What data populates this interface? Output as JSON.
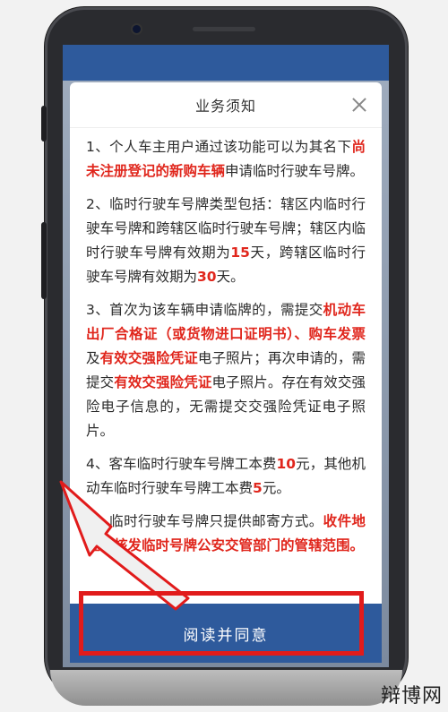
{
  "modal": {
    "title": "业务须知",
    "agree_label": "阅读并同意"
  },
  "notice": [
    {
      "segments": [
        {
          "t": "1、个人车主用户通过该功能可以为其名下"
        },
        {
          "t": "尚未注册登记的新购车辆",
          "red": true
        },
        {
          "t": "申请临时行驶车号牌。"
        }
      ]
    },
    {
      "segments": [
        {
          "t": "2、临时行驶车号牌类型包括：辖区内临时行驶车号牌和跨辖区临时行驶车号牌；辖区内临时行驶车号牌有效期为"
        },
        {
          "t": "15",
          "red": true
        },
        {
          "t": "天，跨辖区临时行驶车号牌有效期为"
        },
        {
          "t": "30",
          "red": true
        },
        {
          "t": "天。"
        }
      ]
    },
    {
      "segments": [
        {
          "t": "3、首次为该车辆申请临牌的，需提交"
        },
        {
          "t": "机动车出厂合格证（或货物进口证明书）、购车发票",
          "red": true
        },
        {
          "t": "及"
        },
        {
          "t": "有效交强险凭证",
          "red": true
        },
        {
          "t": "电子照片；再次申请的，需提交"
        },
        {
          "t": "有效交强险凭证",
          "red": true
        },
        {
          "t": "电子照片。存在有效交强险电子信息的，无需提交交强险凭证电子照片。"
        }
      ]
    },
    {
      "segments": [
        {
          "t": "4、客车临时行驶车号牌工本费"
        },
        {
          "t": "10",
          "red": true
        },
        {
          "t": "元，其他机动车临时行驶车号牌工本费"
        },
        {
          "t": "5",
          "red": true
        },
        {
          "t": "元。"
        }
      ]
    },
    {
      "segments": [
        {
          "t": "5、临时行驶车号牌只提供邮寄方式。"
        },
        {
          "t": "收件地址为核发临时号牌公安交管部门的管辖范围。",
          "red": true
        }
      ]
    }
  ],
  "watermark": "辩博网",
  "colors": {
    "accent": "#2e5a9c",
    "highlight": "#e0261c",
    "annotation": "#e11b1b"
  }
}
